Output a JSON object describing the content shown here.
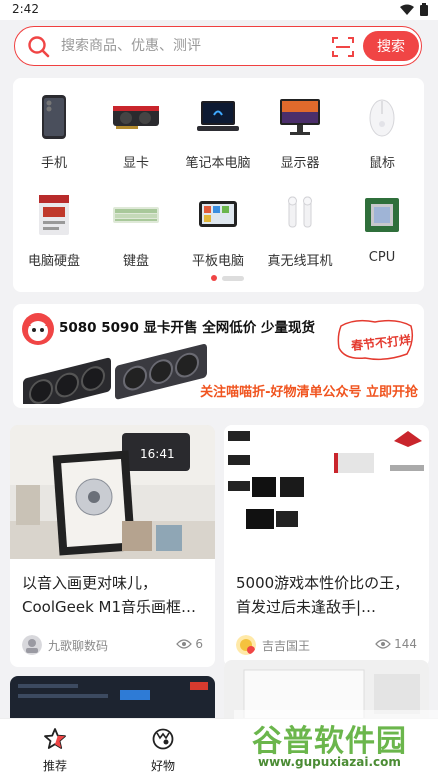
{
  "status_bar": {
    "time": "2:42"
  },
  "search": {
    "placeholder": "搜索商品、优惠、测评",
    "button_label": "搜索"
  },
  "categories": [
    {
      "label": "手机",
      "icon": "phone-icon"
    },
    {
      "label": "显卡",
      "icon": "gpu-icon"
    },
    {
      "label": "笔记本电脑",
      "icon": "laptop-icon"
    },
    {
      "label": "显示器",
      "icon": "monitor-icon"
    },
    {
      "label": "鼠标",
      "icon": "mouse-icon"
    },
    {
      "label": "电脑硬盘",
      "icon": "hdd-icon"
    },
    {
      "label": "键盘",
      "icon": "keyboard-icon"
    },
    {
      "label": "平板电脑",
      "icon": "tablet-icon"
    },
    {
      "label": "真无线耳机",
      "icon": "earbuds-icon"
    },
    {
      "label": "CPU",
      "icon": "cpu-icon"
    }
  ],
  "banner": {
    "title": "5080 5090 显卡开售 全网低价 少量现货",
    "stamp": "春节不打烊",
    "cta": "关注喵喵折-好物清单公众号 立即开抢"
  },
  "feed": [
    {
      "title": "以音入画更对味儿，CoolGeek M1音乐画框…",
      "author": "九歌聊数码",
      "views": "6"
    },
    {
      "title": "5000游戏本性价比の王，首发过后未逢敌手|…",
      "author": "吉吉国王",
      "views": "144"
    }
  ],
  "bottom_nav": [
    {
      "label": "推荐",
      "icon": "star-icon"
    },
    {
      "label": "好物",
      "icon": "goods-icon"
    }
  ],
  "watermark": {
    "text": "谷普软件园",
    "url": "www.gupuxiazai.com"
  },
  "colors": {
    "accent": "#f04545",
    "watermark": "#6bb64c"
  }
}
